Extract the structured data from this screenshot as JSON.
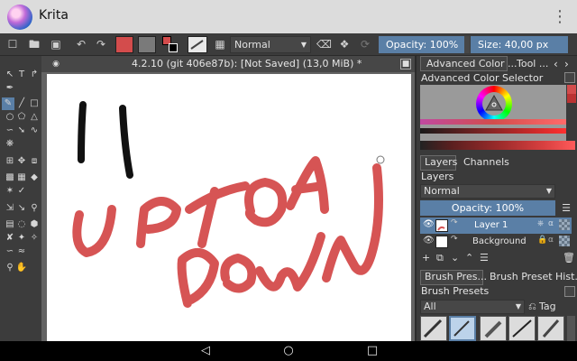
{
  "app": {
    "name": "Krita"
  },
  "toolbar": {
    "blend_mode": "Normal",
    "opacity_label": "Opacity: 100%",
    "size_label": "Size: 40,00 px"
  },
  "document": {
    "title": "4.2.10 (git 406e87b): [Not Saved] (13,0 MiB) *"
  },
  "dockers": {
    "top_tabs": [
      "Advanced Color ...",
      "Tool ..."
    ],
    "color_selector_title": "Advanced Color Selector",
    "layer_tabs": [
      "Layers",
      "Channels"
    ],
    "layers_title": "Layers",
    "layer_blend_mode": "Normal",
    "layer_opacity": "Opacity:  100%",
    "layers": [
      {
        "name": "Layer 1",
        "selected": true
      },
      {
        "name": "Background",
        "selected": false
      }
    ],
    "brush_tabs": [
      "Brush Pres...",
      "Brush Preset Hist..."
    ],
    "brush_presets_title": "Brush Presets",
    "brush_filter": "All",
    "tag_label": "Tag"
  },
  "colors": {
    "accent": "#5a7fa6",
    "foreground_swatch": "#d34c4c",
    "stroke_red": "#d65454",
    "stroke_black": "#111111"
  },
  "icons": [
    "menu-overflow-icon",
    "new-document-icon",
    "open-icon",
    "save-icon",
    "undo-icon",
    "redo-icon",
    "eraser-icon",
    "home-icon",
    "back-icon",
    "recents-icon"
  ]
}
